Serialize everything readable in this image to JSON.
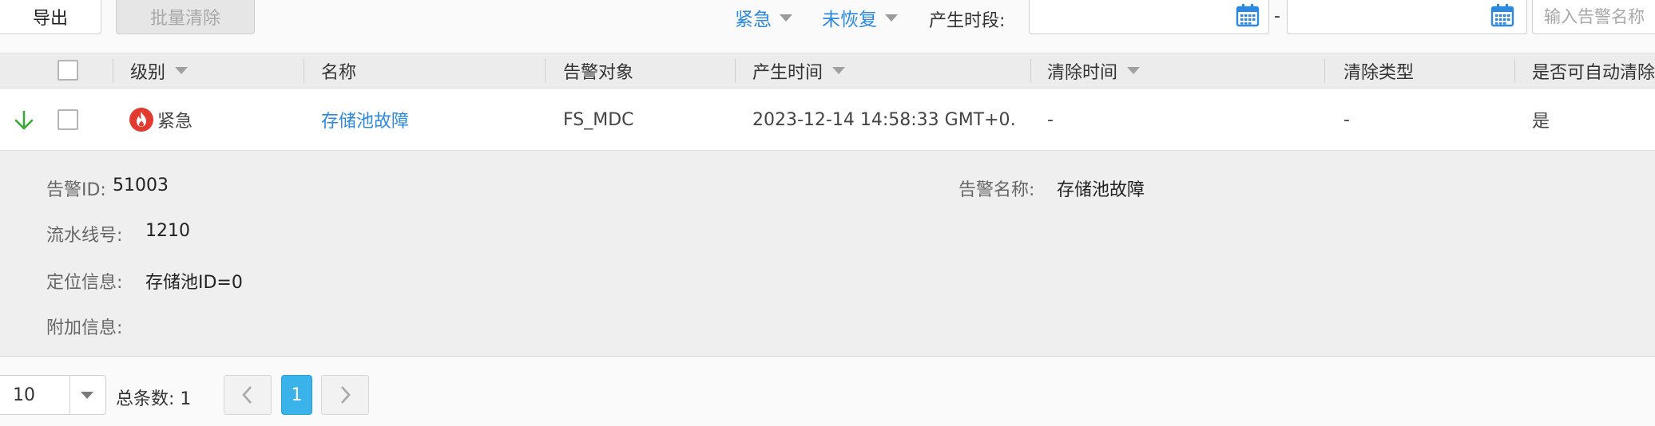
{
  "toolbar": {
    "export_label": "导出",
    "bulk_clear_label": "批量清除",
    "severity_filter": "紧急",
    "status_filter": "未恢复",
    "period_label": "产生时段:",
    "date_separator": "-",
    "search_placeholder": "输入告警名称"
  },
  "table": {
    "columns": [
      {
        "label": "级别",
        "sortable": true
      },
      {
        "label": "名称",
        "sortable": false
      },
      {
        "label": "告警对象",
        "sortable": false
      },
      {
        "label": "产生时间",
        "sortable": true
      },
      {
        "label": "清除时间",
        "sortable": true
      },
      {
        "label": "清除类型",
        "sortable": false
      },
      {
        "label": "是否可自动清除",
        "sortable": false
      }
    ],
    "rows": [
      {
        "level": "紧急",
        "name": "存储池故障",
        "object": "FS_MDC",
        "occur_time": "2023-12-14 14:58:33 GMT+0…",
        "clear_time": "-",
        "clear_type": "-",
        "auto_clear": "是"
      }
    ]
  },
  "detail": {
    "alarm_id_label": "告警ID:",
    "alarm_id": "51003",
    "alarm_name_label": "告警名称:",
    "alarm_name": "存储池故障",
    "serial_label": "流水线号:",
    "serial": "1210",
    "location_label": "定位信息:",
    "location": "存储池ID=0",
    "extra_label": "附加信息:",
    "extra": ""
  },
  "pagination": {
    "page_size": "10",
    "total_label": "总条数: 1",
    "current_page": "1"
  },
  "icons": {
    "calendar": "calendar-icon",
    "expand": "expand-down-arrow-icon",
    "urgent": "fire-icon",
    "prev": "chevron-left-icon",
    "next": "chevron-right-icon"
  },
  "colors": {
    "accent": "#2b8ae0",
    "urgent": "#e23a2e",
    "expand_arrow": "#3aa935",
    "page_current": "#3ab3ea"
  }
}
